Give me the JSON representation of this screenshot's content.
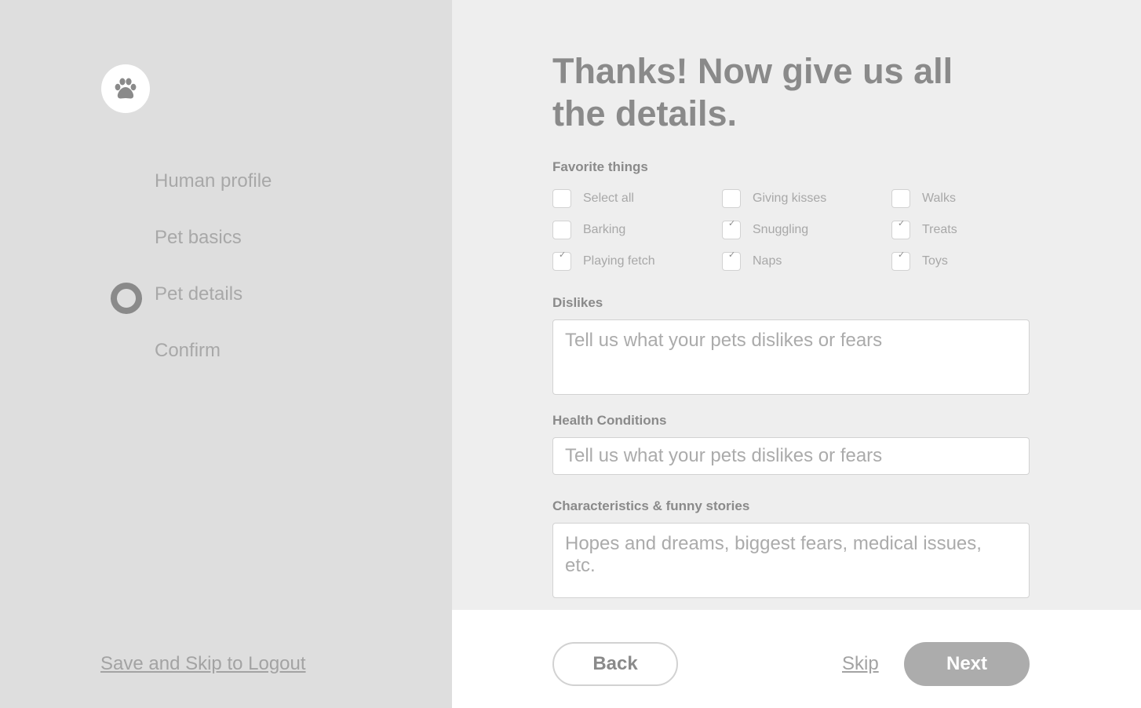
{
  "sidebar": {
    "logo_icon": "paw-icon",
    "steps": [
      {
        "label": "Human profile",
        "active": false
      },
      {
        "label": "Pet basics",
        "active": false
      },
      {
        "label": "Pet details",
        "active": true
      },
      {
        "label": "Confirm",
        "active": false
      }
    ],
    "save_skip_label": "Save and Skip to Logout"
  },
  "main": {
    "title": "Thanks! Now give us all the details.",
    "favorites": {
      "label": "Favorite things",
      "options": [
        {
          "label": "Select all",
          "checked": false
        },
        {
          "label": "Giving kisses",
          "checked": false
        },
        {
          "label": "Walks",
          "checked": false
        },
        {
          "label": "Barking",
          "checked": false
        },
        {
          "label": "Snuggling",
          "checked": true
        },
        {
          "label": "Treats",
          "checked": true
        },
        {
          "label": "Playing fetch",
          "checked": true
        },
        {
          "label": "Naps",
          "checked": true
        },
        {
          "label": "Toys",
          "checked": true
        }
      ]
    },
    "dislikes": {
      "label": "Dislikes",
      "placeholder": "Tell us what your pets dislikes or fears"
    },
    "health": {
      "label": "Health Conditions",
      "placeholder": "Tell us what your pets dislikes or fears"
    },
    "stories": {
      "label": "Characteristics & funny stories",
      "placeholder": "Hopes and dreams, biggest fears, medical issues, etc."
    }
  },
  "footer": {
    "back_label": "Back",
    "skip_label": "Skip",
    "next_label": "Next"
  },
  "colors": {
    "sidebar_bg": "#dedede",
    "main_bg": "#eeeeee",
    "text_dark": "#8a8a8a",
    "text_light": "#a8a8a8",
    "next_button_bg": "#acacac"
  }
}
